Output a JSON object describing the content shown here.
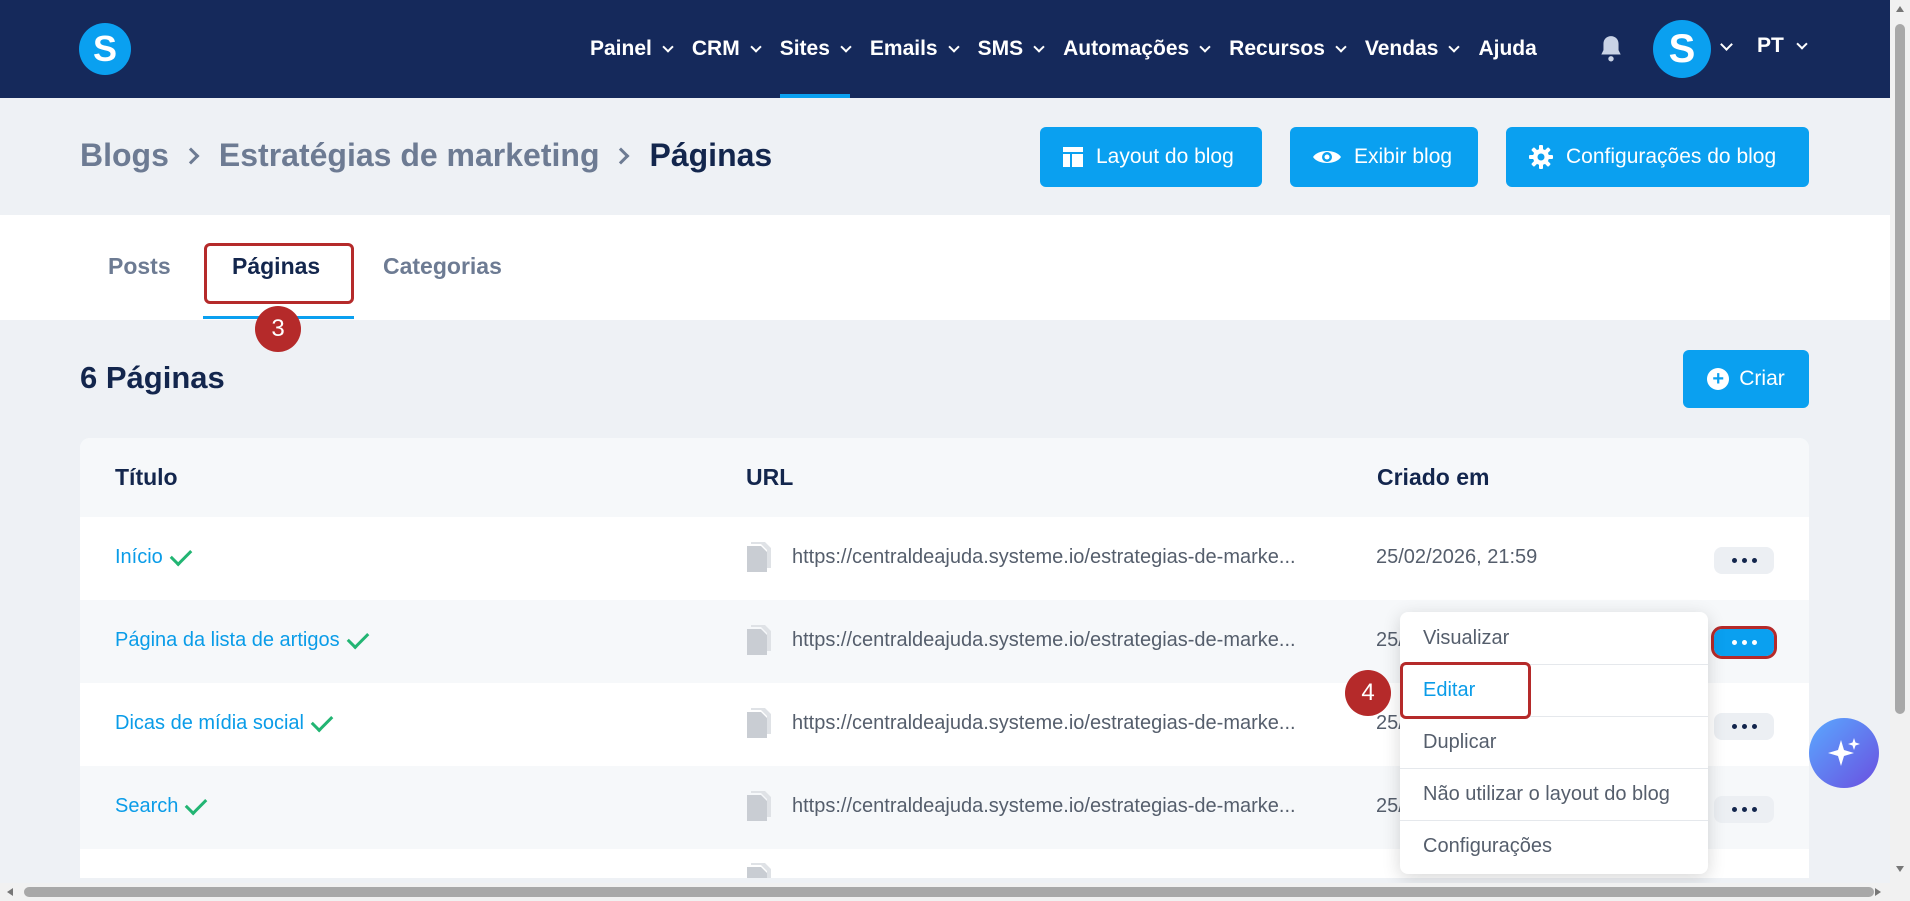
{
  "logo": {
    "letter": "S"
  },
  "nav": {
    "items": [
      {
        "label": "Painel",
        "has_dropdown": true
      },
      {
        "label": "CRM",
        "has_dropdown": true
      },
      {
        "label": "Sites",
        "has_dropdown": true,
        "active": true
      },
      {
        "label": "Emails",
        "has_dropdown": true
      },
      {
        "label": "SMS",
        "has_dropdown": true
      },
      {
        "label": "Automações",
        "has_dropdown": true
      },
      {
        "label": "Recursos",
        "has_dropdown": true
      },
      {
        "label": "Vendas",
        "has_dropdown": true
      },
      {
        "label": "Ajuda",
        "has_dropdown": false
      }
    ],
    "avatar_letter": "S",
    "language": "PT"
  },
  "breadcrumb": {
    "items": [
      "Blogs",
      "Estratégias de marketing",
      "Páginas"
    ]
  },
  "header_buttons": {
    "layout": "Layout do blog",
    "view": "Exibir blog",
    "settings": "Configurações do blog"
  },
  "tabs": [
    "Posts",
    "Páginas",
    "Categorias"
  ],
  "section": {
    "title": "6 Páginas",
    "create_label": "Criar"
  },
  "table": {
    "columns": [
      "Título",
      "URL",
      "Criado em"
    ],
    "rows": [
      {
        "title": "Início",
        "url": "https://centraldeajuda.systeme.io/estrategias-de-marke...",
        "created": "25/02/2026, 21:59"
      },
      {
        "title": "Página da lista de artigos",
        "url": "https://centraldeajuda.systeme.io/estrategias-de-marke...",
        "created": "25/"
      },
      {
        "title": "Dicas de mídia social",
        "url": "https://centraldeajuda.systeme.io/estrategias-de-marke...",
        "created": "25/"
      },
      {
        "title": "Search",
        "url": "https://centraldeajuda.systeme.io/estrategias-de-marke...",
        "created": "25/"
      }
    ]
  },
  "menu": {
    "items": [
      "Visualizar",
      "Editar",
      "Duplicar",
      "Não utilizar o layout do blog",
      "Configurações"
    ]
  },
  "annotations": {
    "step_tab": "3",
    "step_edit": "4"
  },
  "colors": {
    "nav_bg": "#15295b",
    "accent": "#0aa0f0",
    "annotation": "#b52a2a",
    "check": "#22b573"
  }
}
